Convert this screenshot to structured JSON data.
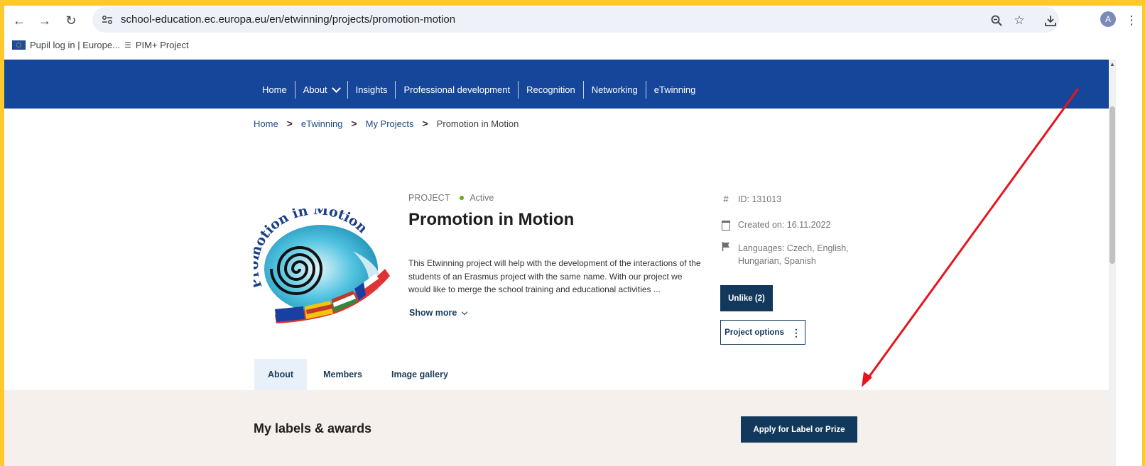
{
  "browser": {
    "url": "school-education.ec.europa.eu/en/etwinning/projects/promotion-motion",
    "bookmarks": [
      {
        "label": "Pupil log in | Europe...",
        "icon": "eu-flag-icon"
      },
      {
        "label": "PIM+ Project",
        "icon": "pim-icon"
      }
    ],
    "profile_initial": "A",
    "icons": [
      "back-arrow-icon",
      "forward-arrow-icon",
      "reload-icon",
      "site-settings-icon",
      "zoom-icon",
      "star-icon",
      "download-icon",
      "kebab-menu-icon"
    ]
  },
  "nav": {
    "items": [
      {
        "label": "Home"
      },
      {
        "label": "About",
        "has_dropdown": true
      },
      {
        "label": "Insights"
      },
      {
        "label": "Professional development"
      },
      {
        "label": "Recognition"
      },
      {
        "label": "Networking"
      },
      {
        "label": "eTwinning"
      }
    ]
  },
  "breadcrumb": {
    "items": [
      "Home",
      "eTwinning",
      "My Projects"
    ],
    "current": "Promotion in Motion",
    "separator": ">"
  },
  "project": {
    "type_label": "PROJECT",
    "status": "Active",
    "title": "Promotion in Motion",
    "logo_text": "Promotion in Motion",
    "description": "This Etwinning project will help with the development of the interactions of the students of an Erasmus project with the same name. With our project we would like to merge the school training and educational activities ...",
    "show_more": "Show more",
    "id_label": "ID: 131013",
    "created_label": "Created on: 16.11.2022",
    "languages_label": "Languages: Czech, English, Hungarian, Spanish",
    "unlike_button": "Unlike (2)",
    "options_button": "Project options"
  },
  "tabs": [
    {
      "label": "About",
      "active": true
    },
    {
      "label": "Members",
      "active": false
    },
    {
      "label": "Image gallery",
      "active": false
    }
  ],
  "awards": {
    "title": "My labels & awards",
    "apply_button": "Apply for Label or Prize"
  },
  "colors": {
    "nav_bg": "#16469a",
    "button_dark": "#12395b",
    "status_active": "#6aaa15",
    "awards_bg": "#f5f0eb",
    "annotation_arrow": "#e8141c",
    "screen_border": "#ffc82c"
  }
}
